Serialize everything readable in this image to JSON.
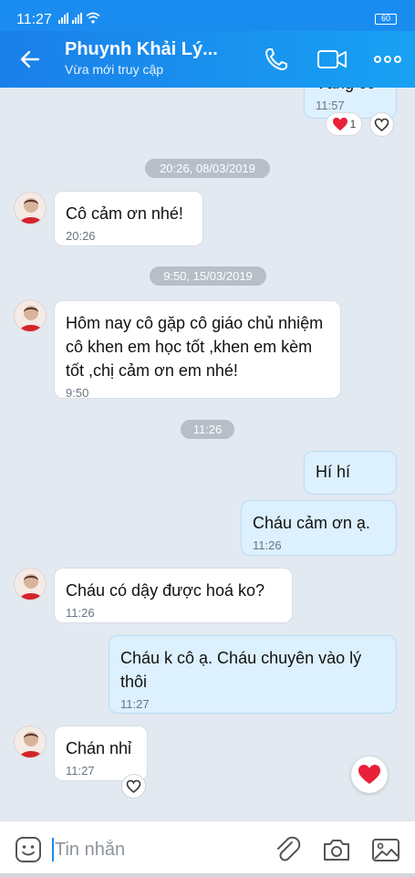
{
  "status_bar": {
    "time": "11:27",
    "battery": "60"
  },
  "header": {
    "contact_name": "Phuynh Khải Lý...",
    "contact_status": "Vừa mới truy cập"
  },
  "messages": [
    {
      "direction": "out",
      "text": "Vâng cô",
      "time": "11:57",
      "reaction_count": "1"
    },
    {
      "direction": "date",
      "text": "20:26, 08/03/2019"
    },
    {
      "direction": "in",
      "text": "Cô cảm ơn nhé!",
      "time": "20:26"
    },
    {
      "direction": "date",
      "text": "9:50, 15/03/2019"
    },
    {
      "direction": "in",
      "text": "Hôm nay cô gặp cô giáo chủ nhiệm cô khen em học tốt ,khen em kèm tốt ,chị cảm ơn em nhé!",
      "time": "9:50"
    },
    {
      "direction": "date",
      "text": "11:26"
    },
    {
      "direction": "out",
      "text": "Hí hí",
      "time": ""
    },
    {
      "direction": "out",
      "text": "Cháu cảm ơn ạ.",
      "time": "11:26"
    },
    {
      "direction": "in",
      "text": "Cháu có dậy được hoá ko?",
      "time": "11:26"
    },
    {
      "direction": "out",
      "text": "Cháu k cô ạ. Cháu chuyên vào lý thôi",
      "time": "11:27"
    },
    {
      "direction": "in",
      "text": "Chán nhỉ",
      "time": "11:27"
    }
  ],
  "input": {
    "placeholder": "Tin nhắn"
  },
  "colors": {
    "brand": "#1a8cf0",
    "outgoing_bubble": "#dcf0fd",
    "background": "#e2e9f1",
    "heart": "#e8203a"
  }
}
